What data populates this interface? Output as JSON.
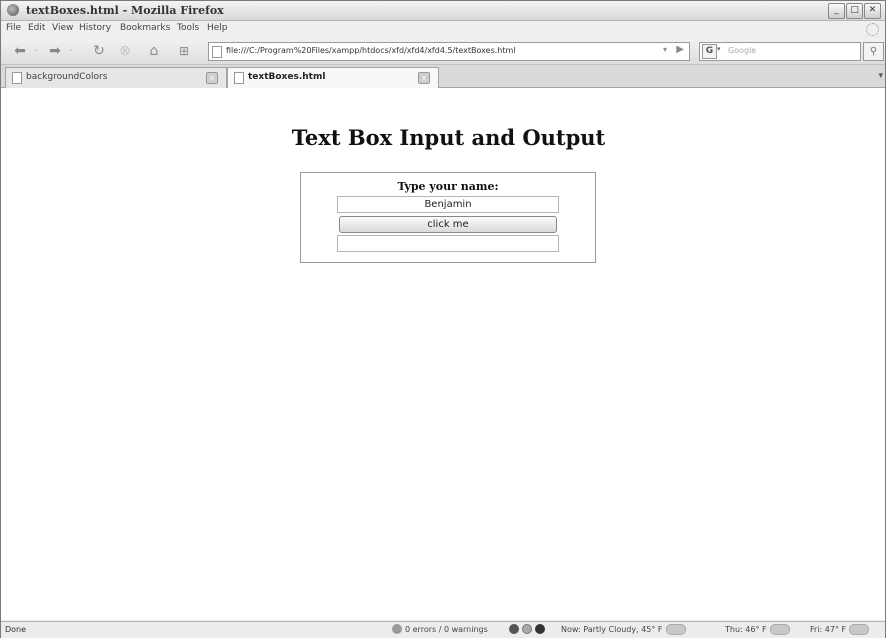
{
  "window": {
    "title": "textBoxes.html - Mozilla Firefox"
  },
  "menu": [
    "File",
    "Edit",
    "View",
    "History",
    "Bookmarks",
    "Tools",
    "Help"
  ],
  "navbar": {
    "url": "file:///C:/Program%20Files/xampp/htdocs/xfd/xfd4/xfd4.5/textBoxes.html",
    "search_placeholder": "Google",
    "search_engine": "G"
  },
  "tabs": [
    {
      "label": "backgroundColors",
      "active": false
    },
    {
      "label": "textBoxes.html",
      "active": true
    }
  ],
  "page": {
    "heading": "Text Box Input and Output",
    "prompt": "Type your name:",
    "name_value": "Benjamin",
    "button_label": "click me",
    "output_value": ""
  },
  "status": {
    "text": "Done",
    "errors": "0 errors / 0 warnings",
    "weather_now": "Now: Partly Cloudy, 45° F",
    "weather_thu": "Thu: 46° F",
    "weather_fri": "Fri: 47° F"
  }
}
